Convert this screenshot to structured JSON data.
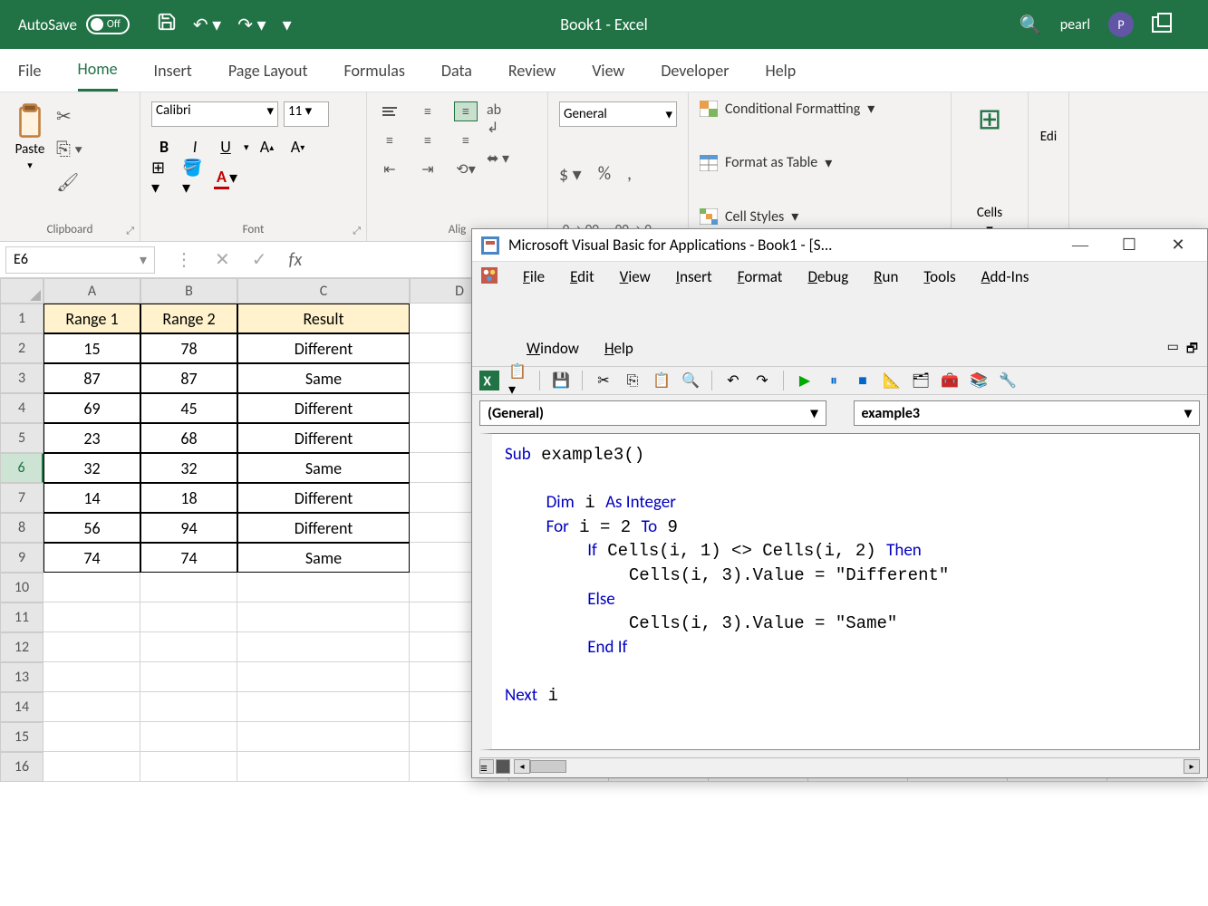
{
  "titlebar": {
    "autosave_label": "AutoSave",
    "autosave_state": "Off",
    "app_title": "Book1 - Excel",
    "username": "pearl",
    "avatar_initial": "P"
  },
  "ribbon_tabs": [
    "File",
    "Home",
    "Insert",
    "Page Layout",
    "Formulas",
    "Data",
    "Review",
    "View",
    "Developer",
    "Help"
  ],
  "active_tab": "Home",
  "ribbon": {
    "clipboard": {
      "paste": "Paste",
      "label": "Clipboard"
    },
    "font": {
      "name": "Calibri",
      "size": "11",
      "label": "Font",
      "bold": "B",
      "italic": "I",
      "underline": "U"
    },
    "alignment": {
      "label": "Alig"
    },
    "number": {
      "format": "General"
    },
    "styles": {
      "cond": "Conditional Formatting",
      "table": "Format as Table",
      "cell": "Cell Styles"
    },
    "cells": {
      "label": "Cells"
    },
    "editing": {
      "label": "Edi"
    }
  },
  "formula_bar": {
    "name_box": "E6"
  },
  "spreadsheet": {
    "col_headers": [
      "A",
      "B",
      "C",
      "D"
    ],
    "row_numbers": [
      1,
      2,
      3,
      4,
      5,
      6,
      7,
      8,
      9,
      10,
      11,
      12,
      13,
      14,
      15,
      16
    ],
    "headers": [
      "Range 1",
      "Range 2",
      "Result"
    ],
    "rows": [
      [
        "15",
        "78",
        "Different"
      ],
      [
        "87",
        "87",
        "Same"
      ],
      [
        "69",
        "45",
        "Different"
      ],
      [
        "23",
        "68",
        "Different"
      ],
      [
        "32",
        "32",
        "Same"
      ],
      [
        "14",
        "18",
        "Different"
      ],
      [
        "56",
        "94",
        "Different"
      ],
      [
        "74",
        "74",
        "Same"
      ]
    ],
    "selected_row": 6
  },
  "vba": {
    "title": "Microsoft Visual Basic for Applications - Book1 - [S...",
    "menus": [
      "File",
      "Edit",
      "View",
      "Insert",
      "Format",
      "Debug",
      "Run",
      "Tools",
      "Add-Ins",
      "Window",
      "Help"
    ],
    "combo_left": "(General)",
    "combo_right": "example3",
    "code_lines": [
      {
        "indent": 0,
        "tokens": [
          {
            "t": "Sub",
            "c": "kw"
          },
          {
            "t": " example3()"
          }
        ]
      },
      {
        "indent": 0,
        "tokens": []
      },
      {
        "indent": 1,
        "tokens": [
          {
            "t": "Dim",
            "c": "kw"
          },
          {
            "t": " i "
          },
          {
            "t": "As Integer",
            "c": "kw"
          }
        ]
      },
      {
        "indent": 1,
        "tokens": [
          {
            "t": "For",
            "c": "kw"
          },
          {
            "t": " i = 2 "
          },
          {
            "t": "To",
            "c": "kw"
          },
          {
            "t": " 9"
          }
        ]
      },
      {
        "indent": 2,
        "tokens": [
          {
            "t": "If",
            "c": "kw"
          },
          {
            "t": " Cells(i, 1) <> Cells(i, 2) "
          },
          {
            "t": "Then",
            "c": "kw"
          }
        ]
      },
      {
        "indent": 3,
        "tokens": [
          {
            "t": "Cells(i, 3).Value = \"Different\""
          }
        ]
      },
      {
        "indent": 2,
        "tokens": [
          {
            "t": "Else",
            "c": "kw"
          }
        ]
      },
      {
        "indent": 3,
        "tokens": [
          {
            "t": "Cells(i, 3).Value = \"Same\""
          }
        ]
      },
      {
        "indent": 2,
        "tokens": [
          {
            "t": "End If",
            "c": "kw"
          }
        ]
      },
      {
        "indent": 0,
        "tokens": []
      },
      {
        "indent": 0,
        "tokens": [
          {
            "t": "Next",
            "c": "kw"
          },
          {
            "t": " i"
          }
        ]
      }
    ]
  }
}
